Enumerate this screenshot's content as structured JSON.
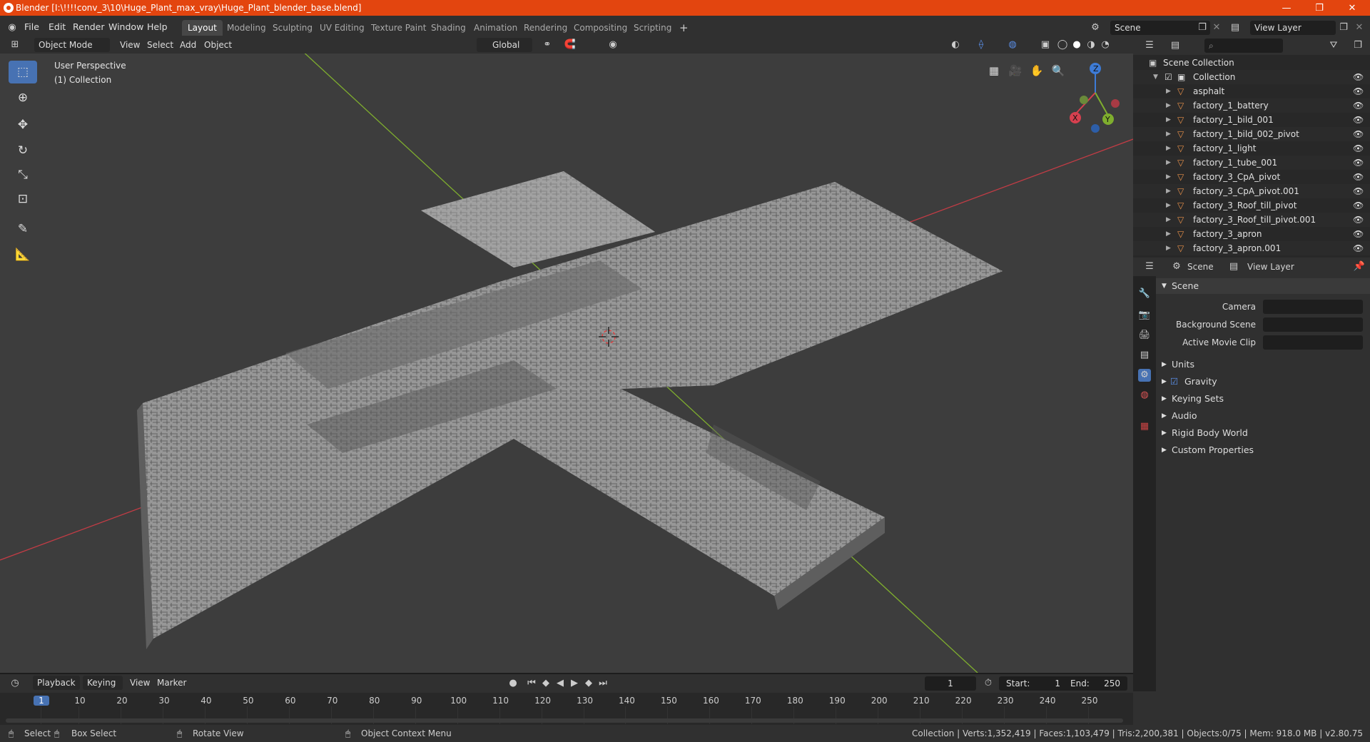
{
  "window": {
    "title": "Blender [I:\\!!!!conv_3\\10\\Huge_Plant_max_vray\\Huge_Plant_blender_base.blend]",
    "minimize": "—",
    "maximize": "❐",
    "close": "✕"
  },
  "menu": [
    "File",
    "Edit",
    "Render",
    "Window",
    "Help"
  ],
  "workspaces": [
    "Layout",
    "Modeling",
    "Sculpting",
    "UV Editing",
    "Texture Paint",
    "Shading",
    "Animation",
    "Rendering",
    "Compositing",
    "Scripting"
  ],
  "add_workspace": "+",
  "scene_name": "Scene",
  "view_layer": "View Layer",
  "viewport_header": {
    "mode": "Object Mode",
    "view": "View",
    "select": "Select",
    "add": "Add",
    "object": "Object",
    "orientation": "Global"
  },
  "viewport": {
    "perspective": "User Perspective",
    "collection": "(1) Collection",
    "gizmo": {
      "x": "X",
      "y": "Y",
      "z": "Z"
    }
  },
  "outliner": {
    "root": "Scene Collection",
    "collection": "Collection",
    "objects": [
      "asphalt",
      "factory_1_battery",
      "factory_1_bild_001",
      "factory_1_bild_002_pivot",
      "factory_1_light",
      "factory_1_tube_001",
      "factory_3_CpA_pivot",
      "factory_3_CpA_pivot.001",
      "factory_3_Roof_till_pivot",
      "factory_3_Roof_till_pivot.001",
      "factory_3_apron",
      "factory_3_apron.001"
    ]
  },
  "properties": {
    "tab_scene": "Scene",
    "tab_view_layer": "View Layer",
    "panel": "Scene",
    "camera": "Camera",
    "background_scene": "Background Scene",
    "active_movie_clip": "Active Movie Clip",
    "sections": [
      "Units",
      "Gravity",
      "Keying Sets",
      "Audio",
      "Rigid Body World",
      "Custom Properties"
    ]
  },
  "timeline": {
    "playback": "Playback",
    "keying": "Keying",
    "view": "View",
    "marker": "Marker",
    "current_frame": "1",
    "start_label": "Start:",
    "start": "1",
    "end_label": "End:",
    "end": "250",
    "ticks": [
      "1",
      "10",
      "20",
      "30",
      "40",
      "50",
      "60",
      "70",
      "80",
      "90",
      "100",
      "110",
      "120",
      "130",
      "140",
      "150",
      "160",
      "170",
      "180",
      "190",
      "200",
      "210",
      "220",
      "230",
      "240",
      "250"
    ]
  },
  "status": {
    "select": "Select",
    "box_select": "Box Select",
    "rotate_view": "Rotate View",
    "context_menu": "Object Context Menu",
    "stats": "Collection | Verts:1,352,419 | Faces:1,103,479 | Tris:2,200,381 | Objects:0/75 | Mem: 918.0 MB | v2.80.75"
  },
  "colors": {
    "accent": "#4772b3",
    "titlebar": "#e3450f",
    "x_axis": "#d6404f",
    "y_axis": "#7fae2e",
    "z_axis": "#3d7bd6"
  }
}
